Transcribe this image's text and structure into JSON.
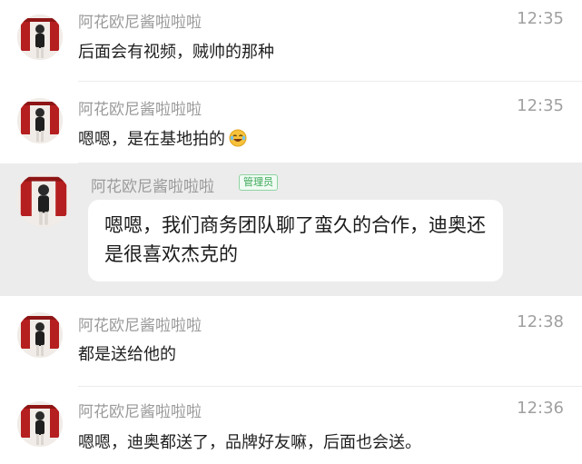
{
  "messages": [
    {
      "sender": "阿花欧尼酱啦啦啦",
      "time": "12:35",
      "text": "后面会有视频，贼帅的那种"
    },
    {
      "sender": "阿花欧尼酱啦啦啦",
      "time": "12:35",
      "text": "嗯嗯，是在基地拍的",
      "emoji": "laughing-tears-emoji"
    },
    {
      "sender": "阿花欧尼酱啦啦啦",
      "badge": "管理员",
      "text": "嗯嗯，我们商务团队聊了蛮久的合作，迪奥还是很喜欢杰克的"
    },
    {
      "sender": "阿花欧尼酱啦啦啦",
      "time": "12:38",
      "text": "都是送给他的"
    },
    {
      "sender": "阿花欧尼酱啦啦啦",
      "time": "12:36",
      "text": "嗯嗯，迪奥都送了，品牌好友嘛，后面也会送。"
    }
  ],
  "colors": {
    "highlight_background": "#ececec",
    "badge_green": "#3aa757",
    "name_gray": "#9a9a9a"
  }
}
